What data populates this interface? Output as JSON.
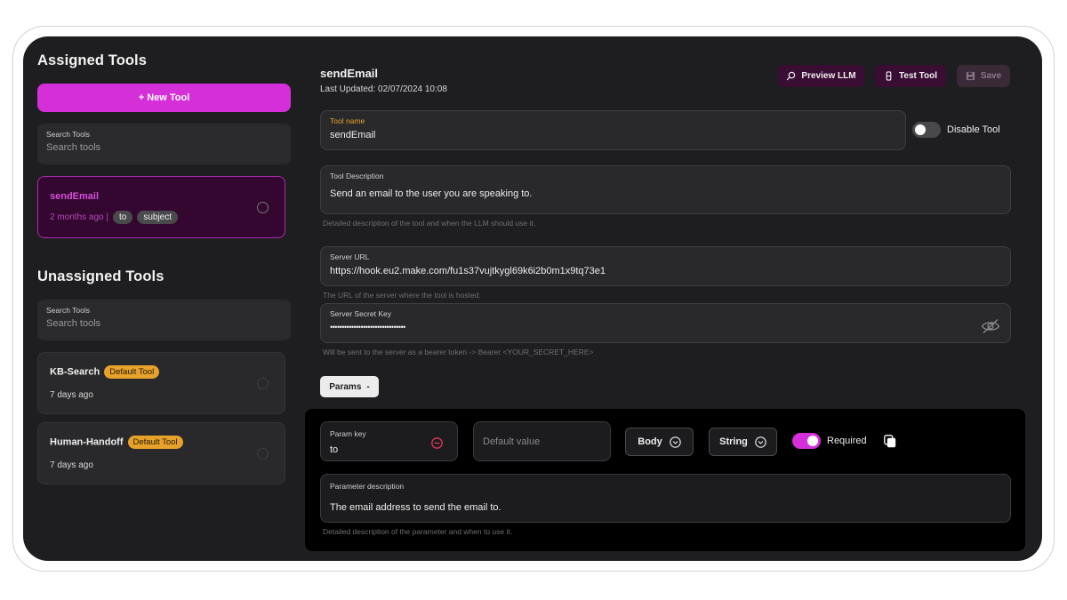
{
  "sidebar": {
    "assigned_title": "Assigned Tools",
    "new_tool_label": "+ New Tool",
    "search_assigned": {
      "label": "Search Tools",
      "placeholder": "Search tools"
    },
    "assigned_tools": [
      {
        "name": "sendEmail",
        "time": "2 months ago |",
        "chips": [
          "to",
          "subject"
        ]
      }
    ],
    "unassigned_title": "Unassigned Tools",
    "search_unassigned": {
      "label": "Search Tools",
      "placeholder": "Search tools"
    },
    "unassigned_tools": [
      {
        "name": "KB-Search",
        "badge": "Default Tool",
        "time": "7 days ago"
      },
      {
        "name": "Human-Handoff",
        "badge": "Default Tool",
        "time": "7 days ago"
      }
    ]
  },
  "header": {
    "title": "sendEmail",
    "last_updated": "Last Updated: 02/07/2024 10:08",
    "preview_label": "Preview LLM",
    "test_label": "Test Tool",
    "save_label": "Save"
  },
  "form": {
    "tool_name": {
      "label": "Tool name",
      "value": "sendEmail"
    },
    "disable_tool_label": "Disable Tool",
    "disable_tool_on": false,
    "description": {
      "label": "Tool Description",
      "value": "Send an email to the user you are speaking to.",
      "helper": "Detailed description of the tool and when the LLM should use it."
    },
    "server_url": {
      "label": "Server URL",
      "value": "https://hook.eu2.make.com/fu1s37vujtkygl69k6i2b0m1x9tq73e1",
      "helper": "The URL of the server where the tool is hosted."
    },
    "secret_key": {
      "label": "Server Secret Key",
      "value": "••••••••••••••••••••••••••••••••",
      "helper": "Will be sent to the server as a bearer token -> Bearer <YOUR_SECRET_HERE>"
    }
  },
  "params": {
    "toggle_label": "Params",
    "toggle_symbol": "-",
    "items": [
      {
        "key_label": "Param key",
        "key_value": "to",
        "default_placeholder": "Default value",
        "location": "Body",
        "type": "String",
        "required_label": "Required",
        "required_on": true,
        "desc_label": "Parameter description",
        "desc_value": "The email address to send the email to.",
        "desc_helper": "Detailed description of the parameter and when to use it."
      }
    ]
  },
  "colors": {
    "accent": "#d42fd9",
    "badge": "#e6a22a",
    "panel": "#1e1e20",
    "danger": "#e0355a"
  }
}
